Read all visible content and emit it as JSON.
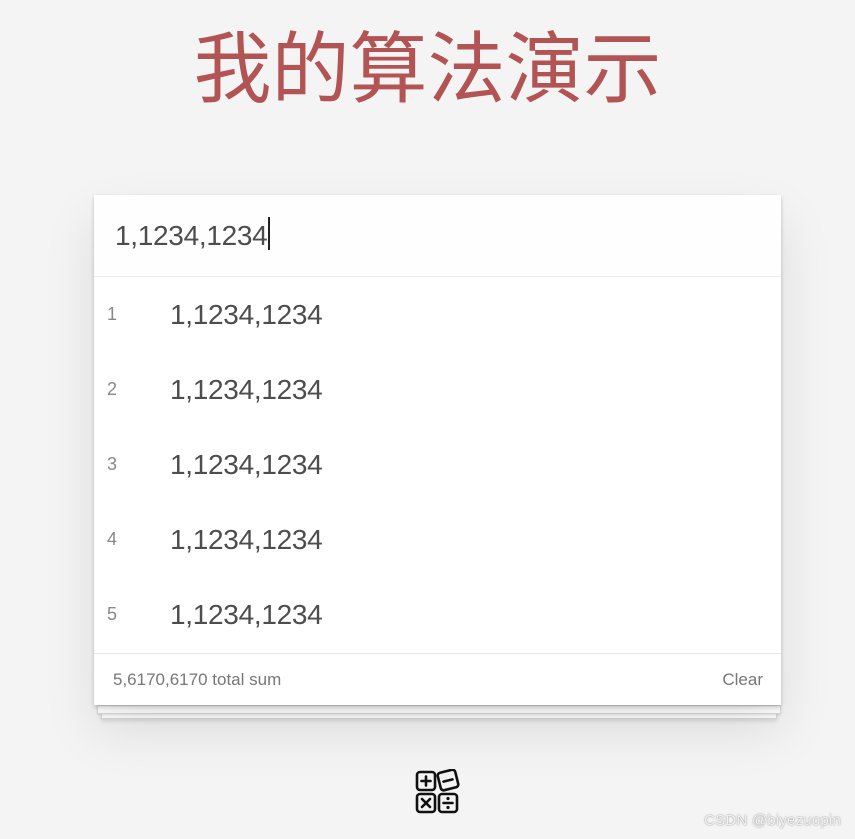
{
  "page": {
    "title": "我的算法演示"
  },
  "entry": {
    "value": "1,1234,1234"
  },
  "rows": [
    {
      "index": "1",
      "value": "1,1234,1234"
    },
    {
      "index": "2",
      "value": "1,1234,1234"
    },
    {
      "index": "3",
      "value": "1,1234,1234"
    },
    {
      "index": "4",
      "value": "1,1234,1234"
    },
    {
      "index": "5",
      "value": "1,1234,1234"
    }
  ],
  "footer": {
    "total": "5,6170,6170 total sum",
    "clear_label": "Clear"
  },
  "icons": {
    "calculator": "calculator-icon"
  },
  "watermark": "CSDN @biyezuopin",
  "colors": {
    "title": "#b35454",
    "background": "#f4f4f4",
    "card": "#ffffff",
    "text": "#4d4d4d"
  }
}
